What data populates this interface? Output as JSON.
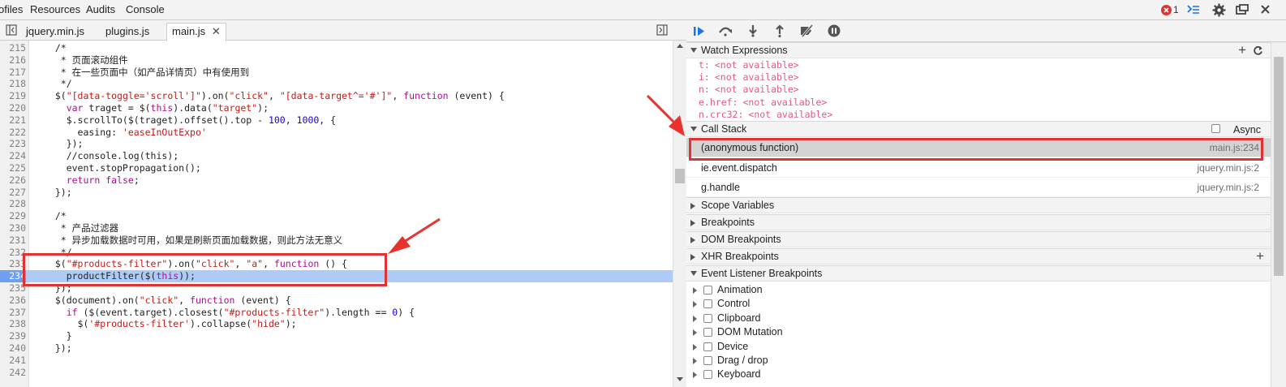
{
  "menubar": {
    "items": [
      "ofiles",
      "Resources",
      "Audits",
      "Console"
    ],
    "error_count": "1"
  },
  "tabs": [
    "jquery.min.js",
    "plugins.js",
    "main.js"
  ],
  "code_lines": [
    {
      "num": "215",
      "text": "  /*"
    },
    {
      "num": "216",
      "text": "   * 页面滚动组件"
    },
    {
      "num": "217",
      "text": "   * 在一些页面中（如产品详情页）中有使用到"
    },
    {
      "num": "218",
      "text": "   */"
    },
    {
      "num": "219",
      "text": "  $(\"[data-toggle='scroll']\").on(\"click\", \"[data-target^='#']\", function (event) {"
    },
    {
      "num": "220",
      "text": "    var traget = $(this).data(\"target\");"
    },
    {
      "num": "221",
      "text": "    $.scrollTo($(traget).offset().top - 100, 1000, {"
    },
    {
      "num": "222",
      "text": "      easing: 'easeInOutExpo'"
    },
    {
      "num": "223",
      "text": "    });"
    },
    {
      "num": "224",
      "text": "    //console.log(this);"
    },
    {
      "num": "225",
      "text": "    event.stopPropagation();"
    },
    {
      "num": "226",
      "text": "    return false;"
    },
    {
      "num": "227",
      "text": "  });"
    },
    {
      "num": "228",
      "text": ""
    },
    {
      "num": "229",
      "text": "  /*"
    },
    {
      "num": "230",
      "text": "   * 产品过滤器"
    },
    {
      "num": "231",
      "text": "   * 异步加载数据时可用，如果是刷新页面加载数据，则此方法无意义"
    },
    {
      "num": "232",
      "text": "   */"
    },
    {
      "num": "233",
      "text": "  $(\"#products-filter\").on(\"click\", \"a\", function () {"
    },
    {
      "num": "234",
      "text": "    productFilter($(this));"
    },
    {
      "num": "235",
      "text": "  });"
    },
    {
      "num": "236",
      "text": "  $(document).on(\"click\", function (event) {"
    },
    {
      "num": "237",
      "text": "    if ($(event.target).closest(\"#products-filter\").length == 0) {"
    },
    {
      "num": "238",
      "text": "      $('#products-filter').collapse(\"hide\");"
    },
    {
      "num": "239",
      "text": "    }"
    },
    {
      "num": "240",
      "text": "  });"
    },
    {
      "num": "241",
      "text": ""
    },
    {
      "num": "242",
      "text": ""
    }
  ],
  "current_line_index": 19,
  "sections": {
    "watch": "Watch Expressions",
    "call_stack": "Call Stack",
    "async": "Async",
    "scope": "Scope Variables",
    "breakpoints": "Breakpoints",
    "dom_breakpoints": "DOM Breakpoints",
    "xhr_breakpoints": "XHR Breakpoints",
    "event_listener": "Event Listener Breakpoints"
  },
  "watch_items": [
    {
      "name": "t:",
      "value": "<not available>"
    },
    {
      "name": "i:",
      "value": "<not available>"
    },
    {
      "name": "n:",
      "value": "<not available>"
    },
    {
      "name": "e.href:",
      "value": "<not available>"
    },
    {
      "name": "n.crc32:",
      "value": "<not available>"
    }
  ],
  "call_stack": [
    {
      "fn": "(anonymous function)",
      "loc": "main.js:234"
    },
    {
      "fn": "ie.event.dispatch",
      "loc": "jquery.min.js:2"
    },
    {
      "fn": "g.handle",
      "loc": "jquery.min.js:2"
    }
  ],
  "event_categories": [
    "Animation",
    "Control",
    "Clipboard",
    "DOM Mutation",
    "Device",
    "Drag / drop",
    "Keyboard"
  ],
  "colors": {
    "accent": "#1a73e8",
    "error": "#e03232",
    "highlight": "#aecbf7"
  }
}
